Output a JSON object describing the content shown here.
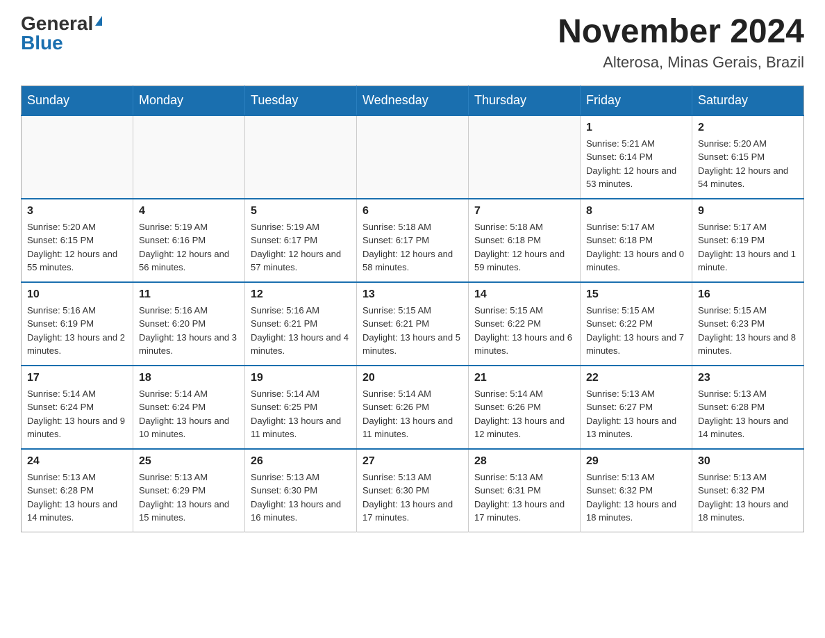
{
  "header": {
    "logo_general": "General",
    "logo_blue": "Blue",
    "month_title": "November 2024",
    "location": "Alterosa, Minas Gerais, Brazil"
  },
  "weekdays": [
    "Sunday",
    "Monday",
    "Tuesday",
    "Wednesday",
    "Thursday",
    "Friday",
    "Saturday"
  ],
  "weeks": [
    [
      {
        "day": "",
        "info": ""
      },
      {
        "day": "",
        "info": ""
      },
      {
        "day": "",
        "info": ""
      },
      {
        "day": "",
        "info": ""
      },
      {
        "day": "",
        "info": ""
      },
      {
        "day": "1",
        "info": "Sunrise: 5:21 AM\nSunset: 6:14 PM\nDaylight: 12 hours and 53 minutes."
      },
      {
        "day": "2",
        "info": "Sunrise: 5:20 AM\nSunset: 6:15 PM\nDaylight: 12 hours and 54 minutes."
      }
    ],
    [
      {
        "day": "3",
        "info": "Sunrise: 5:20 AM\nSunset: 6:15 PM\nDaylight: 12 hours and 55 minutes."
      },
      {
        "day": "4",
        "info": "Sunrise: 5:19 AM\nSunset: 6:16 PM\nDaylight: 12 hours and 56 minutes."
      },
      {
        "day": "5",
        "info": "Sunrise: 5:19 AM\nSunset: 6:17 PM\nDaylight: 12 hours and 57 minutes."
      },
      {
        "day": "6",
        "info": "Sunrise: 5:18 AM\nSunset: 6:17 PM\nDaylight: 12 hours and 58 minutes."
      },
      {
        "day": "7",
        "info": "Sunrise: 5:18 AM\nSunset: 6:18 PM\nDaylight: 12 hours and 59 minutes."
      },
      {
        "day": "8",
        "info": "Sunrise: 5:17 AM\nSunset: 6:18 PM\nDaylight: 13 hours and 0 minutes."
      },
      {
        "day": "9",
        "info": "Sunrise: 5:17 AM\nSunset: 6:19 PM\nDaylight: 13 hours and 1 minute."
      }
    ],
    [
      {
        "day": "10",
        "info": "Sunrise: 5:16 AM\nSunset: 6:19 PM\nDaylight: 13 hours and 2 minutes."
      },
      {
        "day": "11",
        "info": "Sunrise: 5:16 AM\nSunset: 6:20 PM\nDaylight: 13 hours and 3 minutes."
      },
      {
        "day": "12",
        "info": "Sunrise: 5:16 AM\nSunset: 6:21 PM\nDaylight: 13 hours and 4 minutes."
      },
      {
        "day": "13",
        "info": "Sunrise: 5:15 AM\nSunset: 6:21 PM\nDaylight: 13 hours and 5 minutes."
      },
      {
        "day": "14",
        "info": "Sunrise: 5:15 AM\nSunset: 6:22 PM\nDaylight: 13 hours and 6 minutes."
      },
      {
        "day": "15",
        "info": "Sunrise: 5:15 AM\nSunset: 6:22 PM\nDaylight: 13 hours and 7 minutes."
      },
      {
        "day": "16",
        "info": "Sunrise: 5:15 AM\nSunset: 6:23 PM\nDaylight: 13 hours and 8 minutes."
      }
    ],
    [
      {
        "day": "17",
        "info": "Sunrise: 5:14 AM\nSunset: 6:24 PM\nDaylight: 13 hours and 9 minutes."
      },
      {
        "day": "18",
        "info": "Sunrise: 5:14 AM\nSunset: 6:24 PM\nDaylight: 13 hours and 10 minutes."
      },
      {
        "day": "19",
        "info": "Sunrise: 5:14 AM\nSunset: 6:25 PM\nDaylight: 13 hours and 11 minutes."
      },
      {
        "day": "20",
        "info": "Sunrise: 5:14 AM\nSunset: 6:26 PM\nDaylight: 13 hours and 11 minutes."
      },
      {
        "day": "21",
        "info": "Sunrise: 5:14 AM\nSunset: 6:26 PM\nDaylight: 13 hours and 12 minutes."
      },
      {
        "day": "22",
        "info": "Sunrise: 5:13 AM\nSunset: 6:27 PM\nDaylight: 13 hours and 13 minutes."
      },
      {
        "day": "23",
        "info": "Sunrise: 5:13 AM\nSunset: 6:28 PM\nDaylight: 13 hours and 14 minutes."
      }
    ],
    [
      {
        "day": "24",
        "info": "Sunrise: 5:13 AM\nSunset: 6:28 PM\nDaylight: 13 hours and 14 minutes."
      },
      {
        "day": "25",
        "info": "Sunrise: 5:13 AM\nSunset: 6:29 PM\nDaylight: 13 hours and 15 minutes."
      },
      {
        "day": "26",
        "info": "Sunrise: 5:13 AM\nSunset: 6:30 PM\nDaylight: 13 hours and 16 minutes."
      },
      {
        "day": "27",
        "info": "Sunrise: 5:13 AM\nSunset: 6:30 PM\nDaylight: 13 hours and 17 minutes."
      },
      {
        "day": "28",
        "info": "Sunrise: 5:13 AM\nSunset: 6:31 PM\nDaylight: 13 hours and 17 minutes."
      },
      {
        "day": "29",
        "info": "Sunrise: 5:13 AM\nSunset: 6:32 PM\nDaylight: 13 hours and 18 minutes."
      },
      {
        "day": "30",
        "info": "Sunrise: 5:13 AM\nSunset: 6:32 PM\nDaylight: 13 hours and 18 minutes."
      }
    ]
  ]
}
